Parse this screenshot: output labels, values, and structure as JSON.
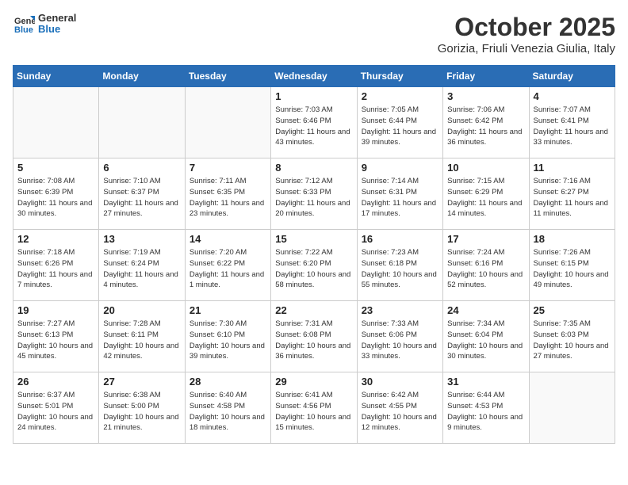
{
  "header": {
    "logo_general": "General",
    "logo_blue": "Blue",
    "month": "October 2025",
    "location": "Gorizia, Friuli Venezia Giulia, Italy"
  },
  "days_of_week": [
    "Sunday",
    "Monday",
    "Tuesday",
    "Wednesday",
    "Thursday",
    "Friday",
    "Saturday"
  ],
  "weeks": [
    [
      {
        "day": "",
        "empty": true
      },
      {
        "day": "",
        "empty": true
      },
      {
        "day": "",
        "empty": true
      },
      {
        "day": "1",
        "sunrise": "7:03 AM",
        "sunset": "6:46 PM",
        "daylight": "11 hours and 43 minutes."
      },
      {
        "day": "2",
        "sunrise": "7:05 AM",
        "sunset": "6:44 PM",
        "daylight": "11 hours and 39 minutes."
      },
      {
        "day": "3",
        "sunrise": "7:06 AM",
        "sunset": "6:42 PM",
        "daylight": "11 hours and 36 minutes."
      },
      {
        "day": "4",
        "sunrise": "7:07 AM",
        "sunset": "6:41 PM",
        "daylight": "11 hours and 33 minutes."
      }
    ],
    [
      {
        "day": "5",
        "sunrise": "7:08 AM",
        "sunset": "6:39 PM",
        "daylight": "11 hours and 30 minutes."
      },
      {
        "day": "6",
        "sunrise": "7:10 AM",
        "sunset": "6:37 PM",
        "daylight": "11 hours and 27 minutes."
      },
      {
        "day": "7",
        "sunrise": "7:11 AM",
        "sunset": "6:35 PM",
        "daylight": "11 hours and 23 minutes."
      },
      {
        "day": "8",
        "sunrise": "7:12 AM",
        "sunset": "6:33 PM",
        "daylight": "11 hours and 20 minutes."
      },
      {
        "day": "9",
        "sunrise": "7:14 AM",
        "sunset": "6:31 PM",
        "daylight": "11 hours and 17 minutes."
      },
      {
        "day": "10",
        "sunrise": "7:15 AM",
        "sunset": "6:29 PM",
        "daylight": "11 hours and 14 minutes."
      },
      {
        "day": "11",
        "sunrise": "7:16 AM",
        "sunset": "6:27 PM",
        "daylight": "11 hours and 11 minutes."
      }
    ],
    [
      {
        "day": "12",
        "sunrise": "7:18 AM",
        "sunset": "6:26 PM",
        "daylight": "11 hours and 7 minutes."
      },
      {
        "day": "13",
        "sunrise": "7:19 AM",
        "sunset": "6:24 PM",
        "daylight": "11 hours and 4 minutes."
      },
      {
        "day": "14",
        "sunrise": "7:20 AM",
        "sunset": "6:22 PM",
        "daylight": "11 hours and 1 minute."
      },
      {
        "day": "15",
        "sunrise": "7:22 AM",
        "sunset": "6:20 PM",
        "daylight": "10 hours and 58 minutes."
      },
      {
        "day": "16",
        "sunrise": "7:23 AM",
        "sunset": "6:18 PM",
        "daylight": "10 hours and 55 minutes."
      },
      {
        "day": "17",
        "sunrise": "7:24 AM",
        "sunset": "6:16 PM",
        "daylight": "10 hours and 52 minutes."
      },
      {
        "day": "18",
        "sunrise": "7:26 AM",
        "sunset": "6:15 PM",
        "daylight": "10 hours and 49 minutes."
      }
    ],
    [
      {
        "day": "19",
        "sunrise": "7:27 AM",
        "sunset": "6:13 PM",
        "daylight": "10 hours and 45 minutes."
      },
      {
        "day": "20",
        "sunrise": "7:28 AM",
        "sunset": "6:11 PM",
        "daylight": "10 hours and 42 minutes."
      },
      {
        "day": "21",
        "sunrise": "7:30 AM",
        "sunset": "6:10 PM",
        "daylight": "10 hours and 39 minutes."
      },
      {
        "day": "22",
        "sunrise": "7:31 AM",
        "sunset": "6:08 PM",
        "daylight": "10 hours and 36 minutes."
      },
      {
        "day": "23",
        "sunrise": "7:33 AM",
        "sunset": "6:06 PM",
        "daylight": "10 hours and 33 minutes."
      },
      {
        "day": "24",
        "sunrise": "7:34 AM",
        "sunset": "6:04 PM",
        "daylight": "10 hours and 30 minutes."
      },
      {
        "day": "25",
        "sunrise": "7:35 AM",
        "sunset": "6:03 PM",
        "daylight": "10 hours and 27 minutes."
      }
    ],
    [
      {
        "day": "26",
        "sunrise": "6:37 AM",
        "sunset": "5:01 PM",
        "daylight": "10 hours and 24 minutes."
      },
      {
        "day": "27",
        "sunrise": "6:38 AM",
        "sunset": "5:00 PM",
        "daylight": "10 hours and 21 minutes."
      },
      {
        "day": "28",
        "sunrise": "6:40 AM",
        "sunset": "4:58 PM",
        "daylight": "10 hours and 18 minutes."
      },
      {
        "day": "29",
        "sunrise": "6:41 AM",
        "sunset": "4:56 PM",
        "daylight": "10 hours and 15 minutes."
      },
      {
        "day": "30",
        "sunrise": "6:42 AM",
        "sunset": "4:55 PM",
        "daylight": "10 hours and 12 minutes."
      },
      {
        "day": "31",
        "sunrise": "6:44 AM",
        "sunset": "4:53 PM",
        "daylight": "10 hours and 9 minutes."
      },
      {
        "day": "",
        "empty": true
      }
    ]
  ]
}
